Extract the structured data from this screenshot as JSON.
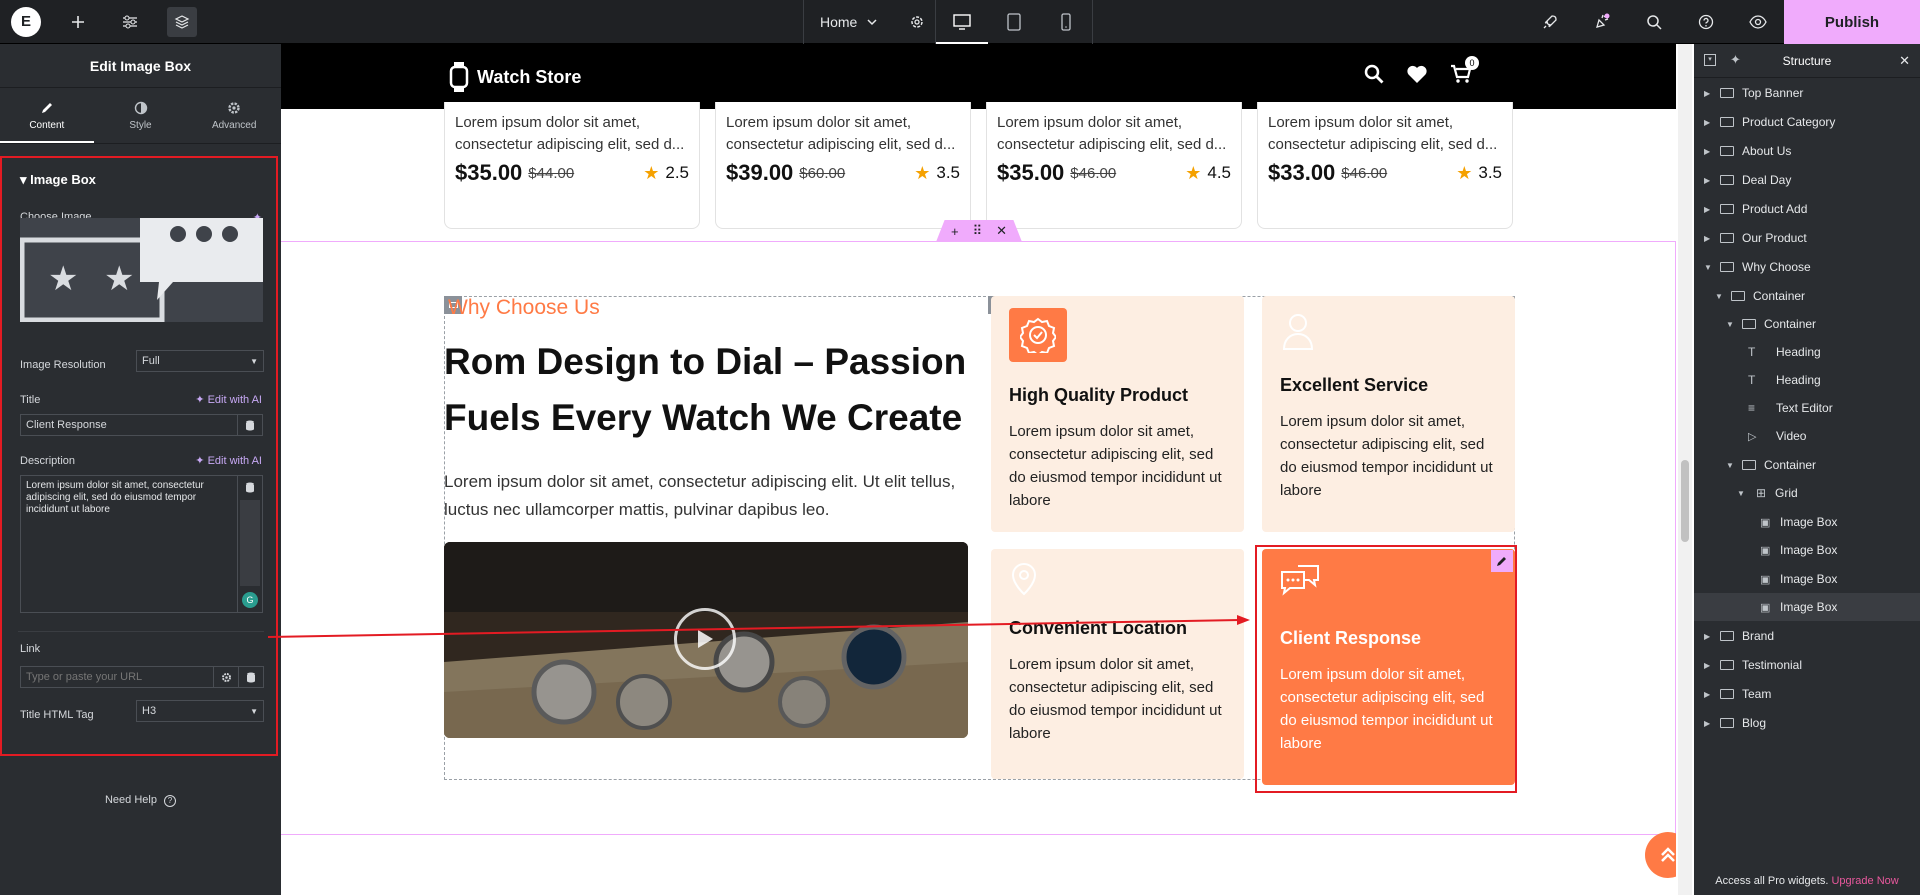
{
  "topbar": {
    "page_name": "Home",
    "publish_label": "Publish"
  },
  "left_panel": {
    "title": "Edit Image Box",
    "tabs": [
      {
        "label": "Content"
      },
      {
        "label": "Style"
      },
      {
        "label": "Advanced"
      }
    ],
    "section_title": "Image Box",
    "choose_image_label": "Choose Image",
    "image_resolution_label": "Image Resolution",
    "image_resolution_value": "Full",
    "title_label": "Title",
    "edit_with_ai": "Edit with AI",
    "title_value": "Client Response",
    "description_label": "Description",
    "description_value": "Lorem ipsum dolor sit amet, consectetur adipiscing elit, sed do eiusmod tempor incididunt ut labore",
    "link_label": "Link",
    "link_placeholder": "Type or paste your URL",
    "title_tag_label": "Title HTML Tag",
    "title_tag_value": "H3",
    "need_help": "Need Help"
  },
  "site": {
    "brand": "Watch Store",
    "cart_count": "0",
    "products": [
      {
        "line1": "Lorem ipsum dolor sit amet,",
        "line2": "consectetur adipiscing elit, sed d...",
        "price": "$35.00",
        "old_price": "$44.00",
        "rating": "2.5"
      },
      {
        "line1": "Lorem ipsum dolor sit amet,",
        "line2": "consectetur adipiscing elit, sed d...",
        "price": "$39.00",
        "old_price": "$60.00",
        "rating": "3.5"
      },
      {
        "line1": "Lorem ipsum dolor sit amet,",
        "line2": "consectetur adipiscing elit, sed d...",
        "price": "$35.00",
        "old_price": "$46.00",
        "rating": "4.5"
      },
      {
        "line1": "Lorem ipsum dolor sit amet,",
        "line2": "consectetur adipiscing elit, sed d...",
        "price": "$33.00",
        "old_price": "$46.00",
        "rating": "3.5"
      }
    ],
    "why": {
      "subtitle": "Why Choose Us",
      "title": "Rom Design to Dial – Passion Fuels Every Watch We Create",
      "text": "Lorem ipsum dolor sit amet, consectetur adipiscing elit. Ut elit tellus, luctus nec ullamcorper mattis, pulvinar dapibus leo."
    },
    "features": [
      {
        "title": "High Quality Product",
        "text": "Lorem ipsum dolor sit amet, consectetur adipiscing elit, sed do eiusmod tempor incididunt ut labore"
      },
      {
        "title": "Excellent Service",
        "text": "Lorem ipsum dolor sit amet, consectetur adipiscing elit, sed do eiusmod tempor incididunt ut labore"
      },
      {
        "title": "Convenient Location",
        "text": "Lorem ipsum dolor sit amet, consectetur adipiscing elit, sed do eiusmod tempor incididunt ut labore"
      },
      {
        "title": "Client Response",
        "text": "Lorem ipsum dolor sit amet, consectetur adipiscing elit, sed do eiusmod tempor incididunt ut labore"
      }
    ]
  },
  "structure": {
    "title": "Structure",
    "items": [
      {
        "label": "Top Banner"
      },
      {
        "label": "Product Category"
      },
      {
        "label": "About Us"
      },
      {
        "label": "Deal Day"
      },
      {
        "label": "Product Add"
      },
      {
        "label": "Our Product"
      },
      {
        "label": "Why Choose"
      },
      {
        "label": "Container"
      },
      {
        "label": "Container"
      },
      {
        "label": "Heading"
      },
      {
        "label": "Heading"
      },
      {
        "label": "Text Editor"
      },
      {
        "label": "Video"
      },
      {
        "label": "Container"
      },
      {
        "label": "Grid"
      },
      {
        "label": "Image Box"
      },
      {
        "label": "Image Box"
      },
      {
        "label": "Image Box"
      },
      {
        "label": "Image Box"
      },
      {
        "label": "Brand"
      },
      {
        "label": "Testimonial"
      },
      {
        "label": "Team"
      },
      {
        "label": "Blog"
      }
    ],
    "pro_note": "Access all Pro widgets.",
    "upgrade_label": "Upgrade Now"
  },
  "colors": {
    "accent_orange": "#ff7a45",
    "feature_bg": "#fdeee2",
    "editor_pink": "#f0abfc",
    "selection_red": "#e31b23"
  },
  "icons": [
    "elementor-logo-icon",
    "plus-icon",
    "sliders-icon",
    "layers-icon",
    "chevron-down-icon",
    "gear-icon",
    "desktop-icon",
    "tablet-icon",
    "mobile-icon",
    "rocket-icon",
    "notification-icon",
    "search-icon",
    "help-icon",
    "eye-icon",
    "pencil-icon",
    "contrast-icon",
    "watch-icon",
    "heart-icon",
    "cart-icon",
    "star-icon",
    "play-icon",
    "badge-check-icon",
    "user-icon",
    "location-icon",
    "chat-icon",
    "double-chevron-up-icon",
    "close-icon"
  ]
}
